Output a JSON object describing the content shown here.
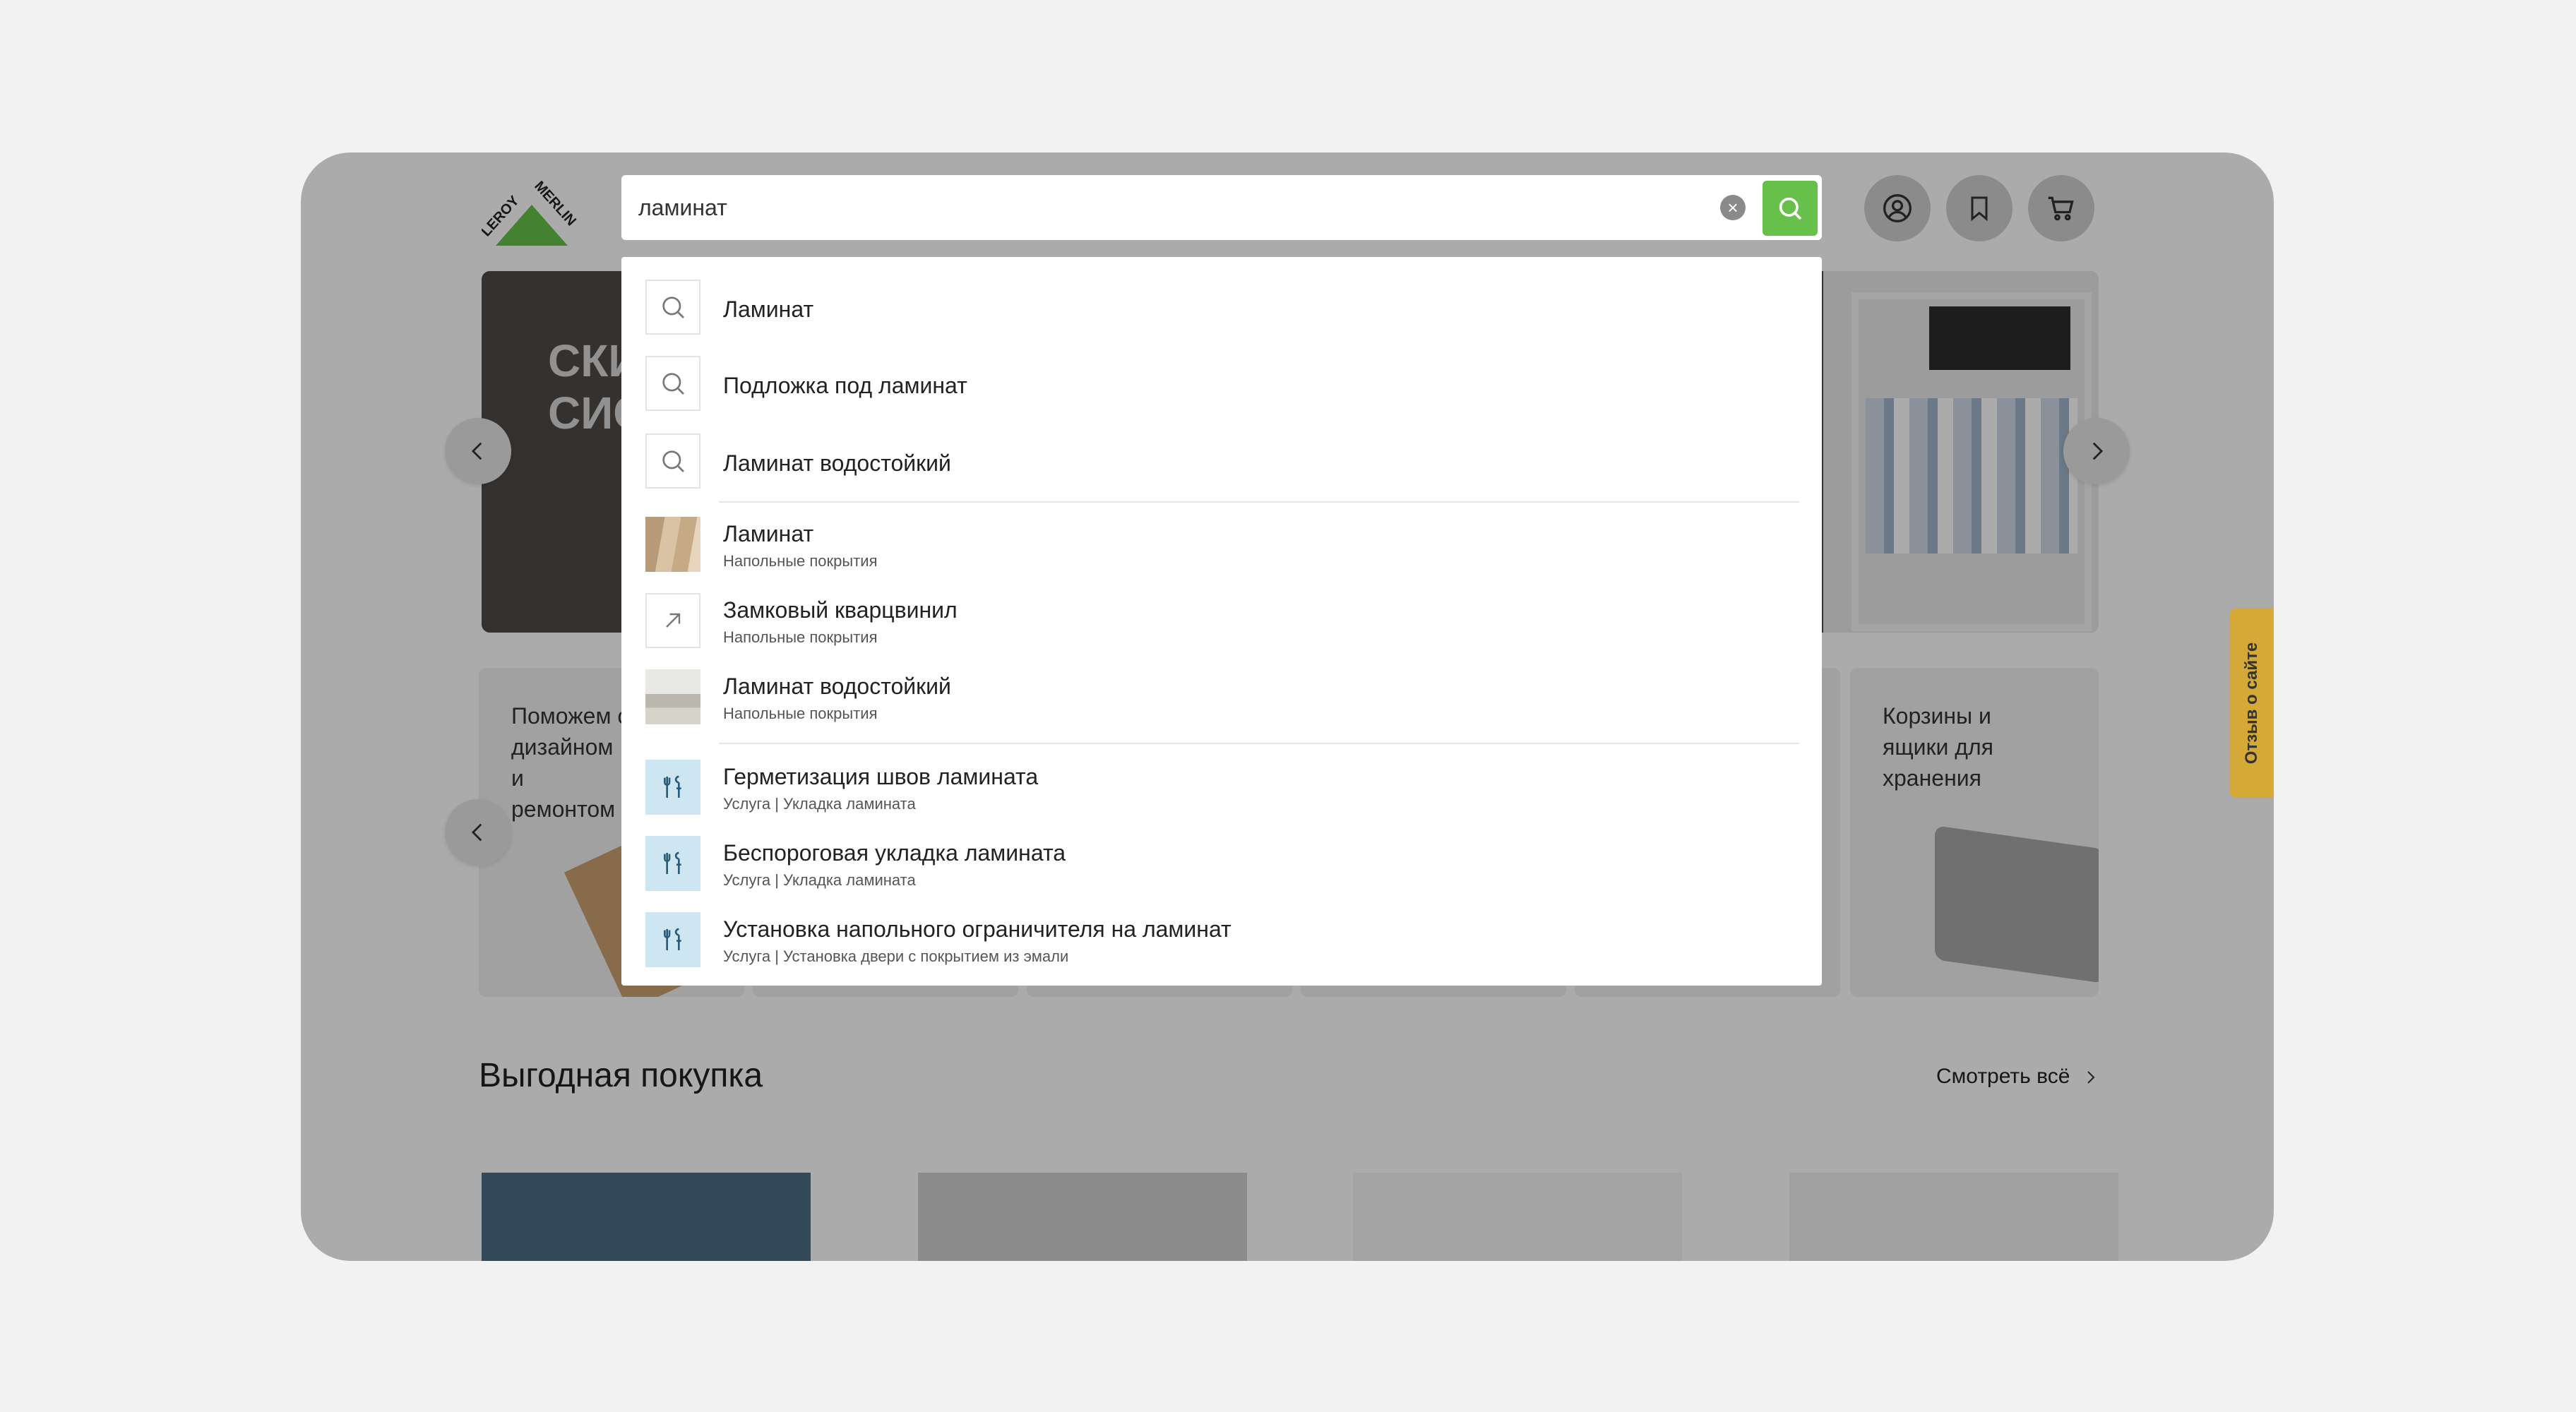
{
  "brand": {
    "logo_text": "LEROY MERLIN",
    "logo_green": "#66c04a"
  },
  "search": {
    "value": "ламинат",
    "clear_icon": "clear-icon",
    "submit_icon": "search-icon",
    "accent": "#66c04a"
  },
  "header_buttons": [
    {
      "name": "profile-icon"
    },
    {
      "name": "bookmark-icon"
    },
    {
      "name": "cart-icon"
    }
  ],
  "banner": {
    "title_line1": "СКИ",
    "title_line2": "СИС"
  },
  "categories": [
    {
      "title": "Поможем с дизайном и ремонтом"
    },
    {
      "title": "Корзины и ящики для хранения"
    }
  ],
  "section": {
    "title": "Выгодная покупка",
    "see_all": "Смотреть всё"
  },
  "suggestions": {
    "queries": [
      {
        "label": "Ламинат"
      },
      {
        "label": "Подложка под ламинат"
      },
      {
        "label": "Ламинат водостойкий"
      }
    ],
    "categories": [
      {
        "label": "Ламинат",
        "sub": "Напольные покрытия"
      },
      {
        "label": "Замковый кварцвинил",
        "sub": "Напольные покрытия"
      },
      {
        "label": "Ламинат водостойкий",
        "sub": "Напольные покрытия"
      }
    ],
    "services": [
      {
        "label": "Герметизация швов ламината",
        "sub": "Услуга | Укладка ламината"
      },
      {
        "label": "Беспороговая укладка ламината",
        "sub": "Услуга | Укладка ламината"
      },
      {
        "label": "Установка напольного ограничителя на ламинат",
        "sub": "Услуга | Установка двери с покрытием из эмали"
      }
    ]
  },
  "feedback": {
    "label": "Отзыв о сайте",
    "color": "#d4a937"
  }
}
